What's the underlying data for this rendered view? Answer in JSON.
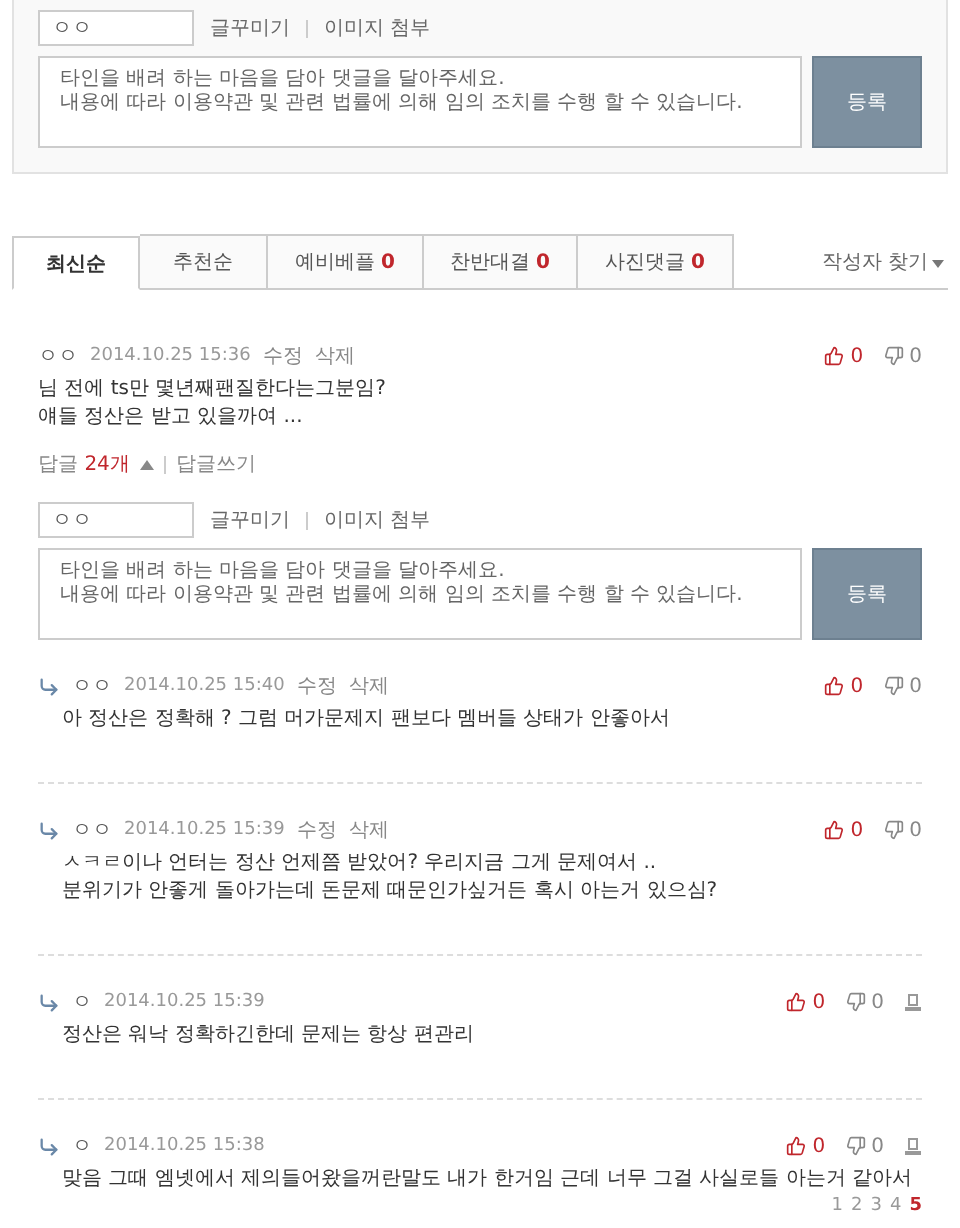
{
  "top_form": {
    "name_value": "ㅇㅇ",
    "links": [
      "글꾸미기",
      "이미지 첨부"
    ],
    "placeholder": "타인을 배려 하는 마음을 담아 댓글을 달아주세요.\n내용에 따라 이용약관 및 관련 법률에 의해 임의 조치를 수행 할 수 있습니다.",
    "submit": "등록"
  },
  "tabs": [
    {
      "label": "최신순",
      "selected": true
    },
    {
      "label": "추천순",
      "selected": false
    },
    {
      "label": "예비베플",
      "count": "0",
      "selected": false
    },
    {
      "label": "찬반대결",
      "count": "0",
      "selected": false
    },
    {
      "label": "사진댓글",
      "count": "0",
      "selected": false
    }
  ],
  "author_search": "작성자 찾기",
  "comment": {
    "author": "ㅇㅇ",
    "date": "2014.10.25 15:36",
    "actions": [
      "수정",
      "삭제"
    ],
    "likes": "0",
    "dislikes": "0",
    "body": "님 전에 ts만 몇년째팬질한다는그분임?\n얘들 정산은 받고 있을까여 ...",
    "reply_bar": {
      "label": "답글",
      "count": "24개",
      "expanded": true,
      "write": "답글쓰기"
    }
  },
  "reply_form": {
    "name_value": "ㅇㅇ",
    "links": [
      "글꾸미기",
      "이미지 첨부"
    ],
    "placeholder": "타인을 배려 하는 마음을 담아 댓글을 달아주세요.\n내용에 따라 이용약관 및 관련 법률에 의해 임의 조치를 수행 할 수 있습니다.",
    "submit": "등록"
  },
  "replies": [
    {
      "author": "ㅇㅇ",
      "date": "2014.10.25 15:40",
      "actions": [
        "수정",
        "삭제"
      ],
      "likes": "0",
      "dislikes": "0",
      "report": false,
      "body": "아 정산은 정확해 ? 그럼 머가문제지 팬보다 멤버들 상태가 안좋아서"
    },
    {
      "author": "ㅇㅇ",
      "date": "2014.10.25 15:39",
      "actions": [
        "수정",
        "삭제"
      ],
      "likes": "0",
      "dislikes": "0",
      "report": false,
      "body": "ㅅㅋㄹ이나 언터는 정산 언제쯤 받았어? 우리지금 그게 문제여서 ..\n분위기가 안좋게 돌아가는데 돈문제 때문인가싶거든 혹시 아는거 있으심?"
    },
    {
      "author": "ㅇ",
      "date": "2014.10.25 15:39",
      "likes": "0",
      "dislikes": "0",
      "report": true,
      "body": "정산은 워낙 정확하긴한데 문제는 항상 편관리"
    },
    {
      "author": "ㅇ",
      "date": "2014.10.25 15:38",
      "likes": "0",
      "dislikes": "0",
      "report": true,
      "body": "맞음 그때 엠넷에서 제의들어왔을꺼란말도 내가 한거임 근데 너무 그걸 사실로들 아는거 같아서"
    }
  ],
  "pages": [
    {
      "label": "1",
      "selected": false
    },
    {
      "label": "2",
      "selected": false
    },
    {
      "label": "3",
      "selected": false
    },
    {
      "label": "4",
      "selected": false
    },
    {
      "label": "5",
      "selected": true
    }
  ]
}
